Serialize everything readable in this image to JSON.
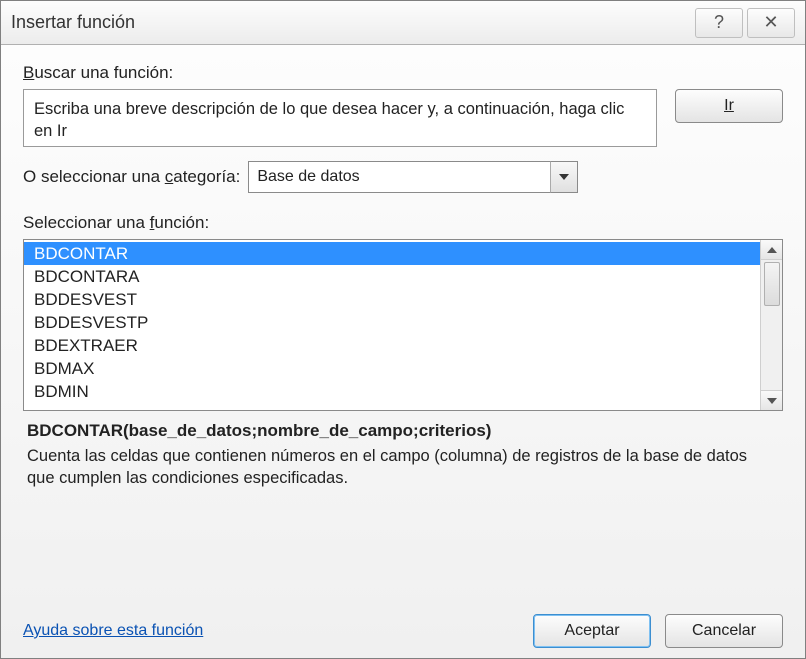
{
  "window": {
    "title": "Insertar función"
  },
  "search": {
    "label_pre": "B",
    "label_rest": "uscar una función:",
    "text": "Escriba una breve descripción de lo que desea hacer y, a continuación, haga clic en Ir",
    "go_pre": "I",
    "go_rest": "r"
  },
  "category": {
    "label_pre": "O seleccionar una ",
    "label_u": "c",
    "label_post": "ategoría:",
    "selected": "Base de datos"
  },
  "list": {
    "label_pre": "Seleccionar una ",
    "label_u": "f",
    "label_post": "unción:",
    "items": [
      "BDCONTAR",
      "BDCONTARA",
      "BDDESVEST",
      "BDDESVESTP",
      "BDEXTRAER",
      "BDMAX",
      "BDMIN"
    ],
    "selected_index": 0
  },
  "description": {
    "signature": "BDCONTAR(base_de_datos;nombre_de_campo;criterios)",
    "text": "Cuenta las celdas que contienen números en el campo (columna) de registros de la base de datos que cumplen las condiciones especificadas."
  },
  "footer": {
    "help_link": "Ayuda sobre esta función",
    "ok": "Aceptar",
    "cancel": "Cancelar"
  }
}
